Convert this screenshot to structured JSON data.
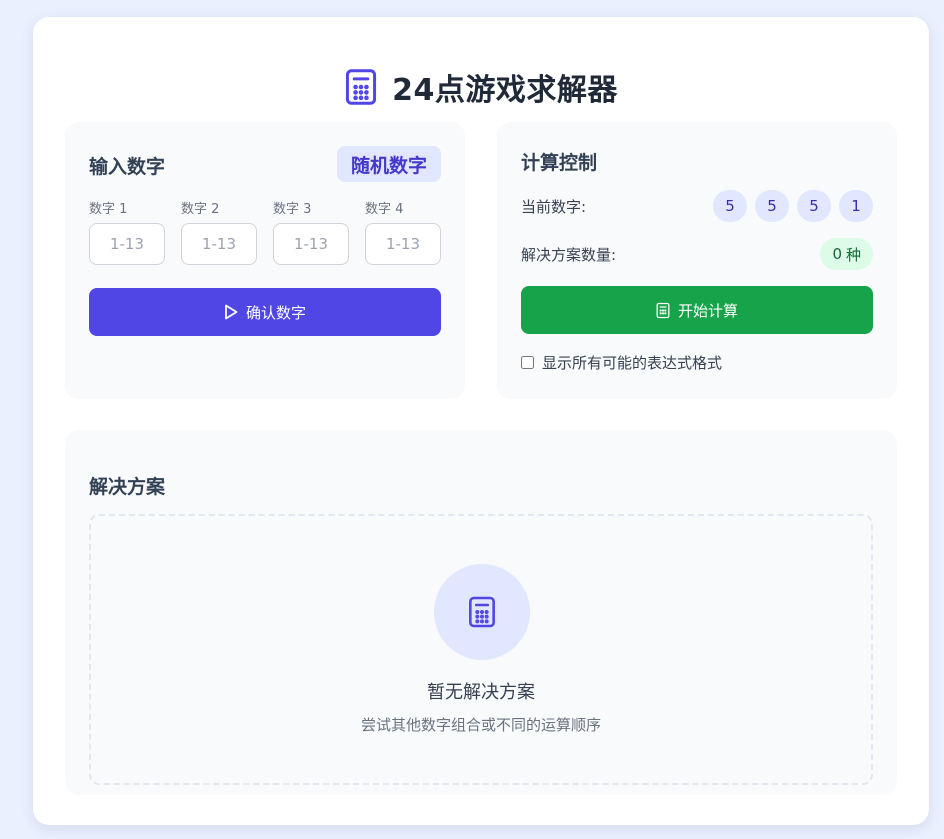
{
  "header": {
    "title": "24点游戏求解器",
    "icon": "calculator-icon"
  },
  "input_panel": {
    "title": "输入数字",
    "random_label": "随机数字",
    "fields": [
      {
        "label": "数字 1",
        "placeholder": "1-13",
        "value": ""
      },
      {
        "label": "数字 2",
        "placeholder": "1-13",
        "value": ""
      },
      {
        "label": "数字 3",
        "placeholder": "1-13",
        "value": ""
      },
      {
        "label": "数字 4",
        "placeholder": "1-13",
        "value": ""
      }
    ],
    "confirm_label": "确认数字",
    "confirm_icon": "play-icon"
  },
  "control_panel": {
    "title": "计算控制",
    "current_label": "当前数字:",
    "current_numbers": [
      "5",
      "5",
      "5",
      "1"
    ],
    "solutions_label": "解决方案数量:",
    "solutions_count": "0",
    "solutions_unit": "种",
    "start_label": "开始计算",
    "start_icon": "calculator-icon",
    "show_all_label": "显示所有可能的表达式格式",
    "show_all_checked": false
  },
  "solutions_panel": {
    "title": "解决方案",
    "empty_title": "暂无解决方案",
    "empty_subtitle": "尝试其他数字组合或不同的运算顺序",
    "empty_icon": "calculator-icon"
  },
  "colors": {
    "primary": "#4f46e5",
    "success": "#16a34a",
    "accent_light": "#e0e7ff",
    "success_light": "#dcfce7",
    "background": "#eaf0fe"
  }
}
